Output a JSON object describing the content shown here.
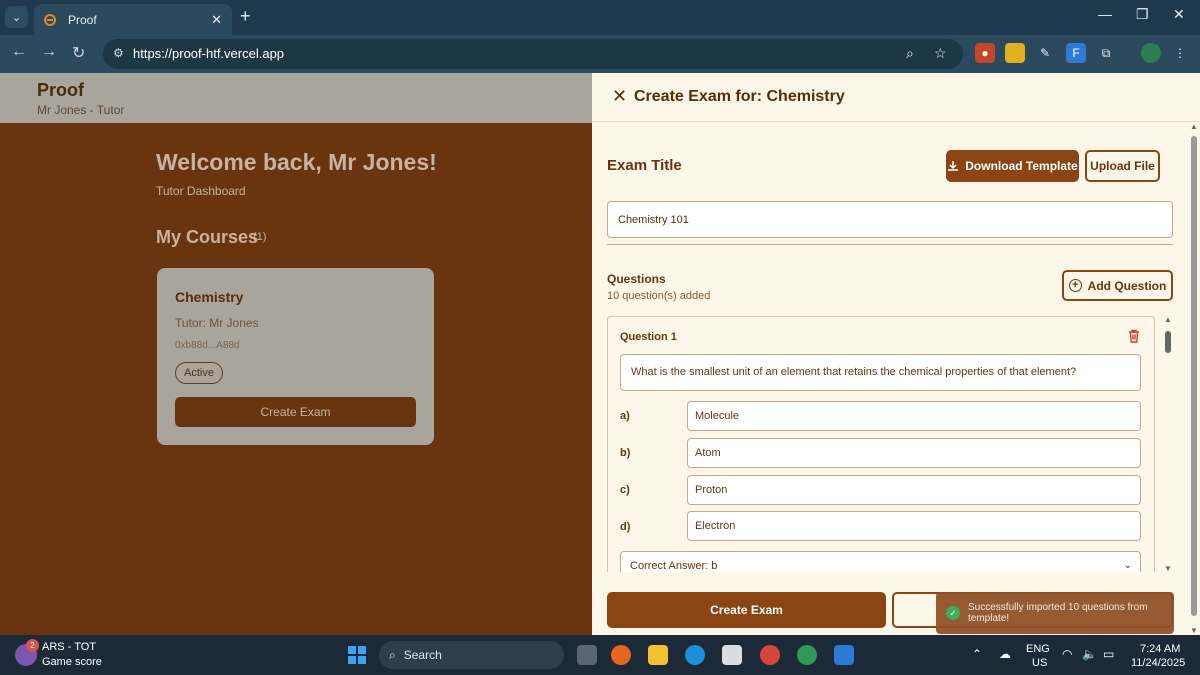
{
  "browser": {
    "tab_title": "Proof",
    "url": "https://proof-htf.vercel.app"
  },
  "app": {
    "name": "Proof",
    "user": "Mr Jones - Tutor",
    "welcome": "Welcome back, Mr Jones!",
    "dashboard_label": "Tutor Dashboard",
    "courses_title": "My Courses",
    "courses_count": "(1)",
    "course": {
      "name": "Chemistry",
      "tutor": "Tutor: Mr Jones",
      "address": "0xb88d...A88d",
      "status": "Active",
      "create_exam_label": "Create Exam"
    }
  },
  "panel": {
    "title": "Create Exam for: Chemistry",
    "exam_title_label": "Exam Title",
    "download_template_label": "Download Template",
    "upload_file_label": "Upload File",
    "exam_title_value": "Chemistry 101",
    "questions_label": "Questions",
    "questions_count": "10 question(s) added",
    "add_question_label": "Add Question",
    "question": {
      "title": "Question 1",
      "text": "What is the smallest unit of an element that retains the chemical properties of that element?",
      "options": [
        {
          "letter": "a)",
          "value": "Molecule"
        },
        {
          "letter": "b)",
          "value": "Atom"
        },
        {
          "letter": "c)",
          "value": "Proton"
        },
        {
          "letter": "d)",
          "value": "Electron"
        }
      ],
      "correct_answer": "Correct Answer: b"
    },
    "create_exam_label": "Create Exam"
  },
  "toast": {
    "message": "Successfully imported 10 questions from template!"
  },
  "taskbar": {
    "widget_title": "ARS - TOT",
    "widget_sub": "Game score",
    "widget_badge": "2",
    "search_label": "Search",
    "lang_top": "ENG",
    "lang_bottom": "US",
    "time": "7:24 AM",
    "date": "11/24/2025"
  },
  "colors": {
    "brand_dark": "#6b3410",
    "brand": "#8b4514",
    "panel_bg": "#fcf7e8",
    "danger": "#d43b2f",
    "success": "#2ea84a"
  }
}
